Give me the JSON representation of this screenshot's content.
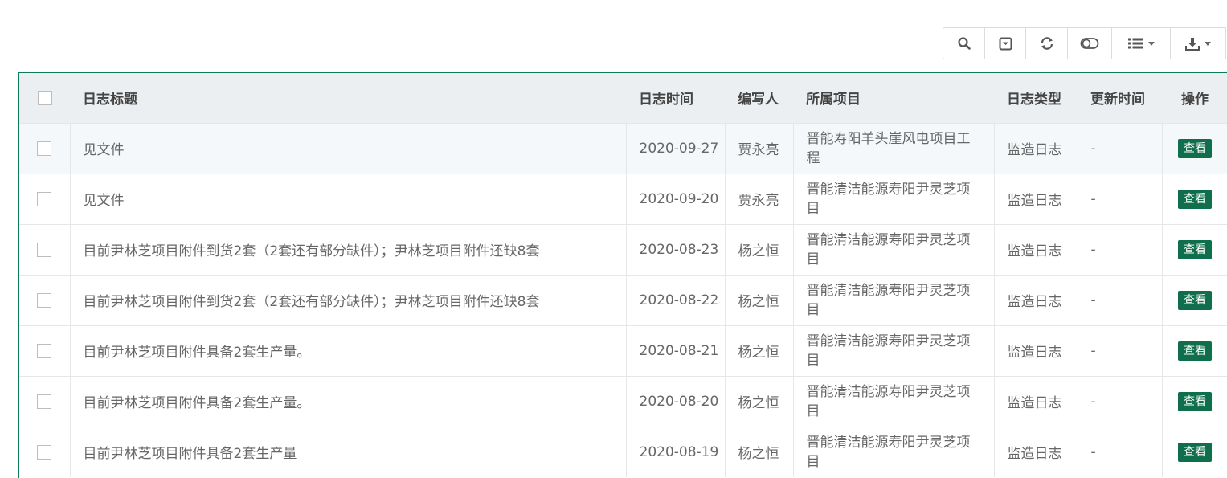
{
  "toolbar": {
    "icons": [
      "search-icon",
      "collapse-icon",
      "refresh-icon",
      "toggle-icon",
      "columns-icon",
      "export-icon"
    ]
  },
  "table": {
    "headers": {
      "title": "日志标题",
      "date": "日志时间",
      "author": "编写人",
      "project": "所属项目",
      "type": "日志类型",
      "updated": "更新时间",
      "action": "操作"
    },
    "rows": [
      {
        "title": "见文件",
        "date": "2020-09-27",
        "author": "贾永亮",
        "project": "晋能寿阳羊头崖风电项目工程",
        "type": "监造日志",
        "updated": "-",
        "action": "查看"
      },
      {
        "title": "见文件",
        "date": "2020-09-20",
        "author": "贾永亮",
        "project": "晋能清洁能源寿阳尹灵芝项目",
        "type": "监造日志",
        "updated": "-",
        "action": "查看"
      },
      {
        "title": "目前尹林芝项目附件到货2套（2套还有部分缺件）；尹林芝项目附件还缺8套",
        "date": "2020-08-23",
        "author": "杨之恒",
        "project": "晋能清洁能源寿阳尹灵芝项目",
        "type": "监造日志",
        "updated": "-",
        "action": "查看"
      },
      {
        "title": "目前尹林芝项目附件到货2套（2套还有部分缺件）；尹林芝项目附件还缺8套",
        "date": "2020-08-22",
        "author": "杨之恒",
        "project": "晋能清洁能源寿阳尹灵芝项目",
        "type": "监造日志",
        "updated": "-",
        "action": "查看"
      },
      {
        "title": "目前尹林芝项目附件具备2套生产量。",
        "date": "2020-08-21",
        "author": "杨之恒",
        "project": "晋能清洁能源寿阳尹灵芝项目",
        "type": "监造日志",
        "updated": "-",
        "action": "查看"
      },
      {
        "title": "目前尹林芝项目附件具备2套生产量。",
        "date": "2020-08-20",
        "author": "杨之恒",
        "project": "晋能清洁能源寿阳尹灵芝项目",
        "type": "监造日志",
        "updated": "-",
        "action": "查看"
      },
      {
        "title": "目前尹林芝项目附件具备2套生产量",
        "date": "2020-08-19",
        "author": "杨之恒",
        "project": "晋能清洁能源寿阳尹灵芝项目",
        "type": "监造日志",
        "updated": "-",
        "action": "查看"
      }
    ]
  },
  "colors": {
    "accent": "#0f6e4b",
    "header_bg": "#eceff1",
    "border": "#0b7e57"
  }
}
